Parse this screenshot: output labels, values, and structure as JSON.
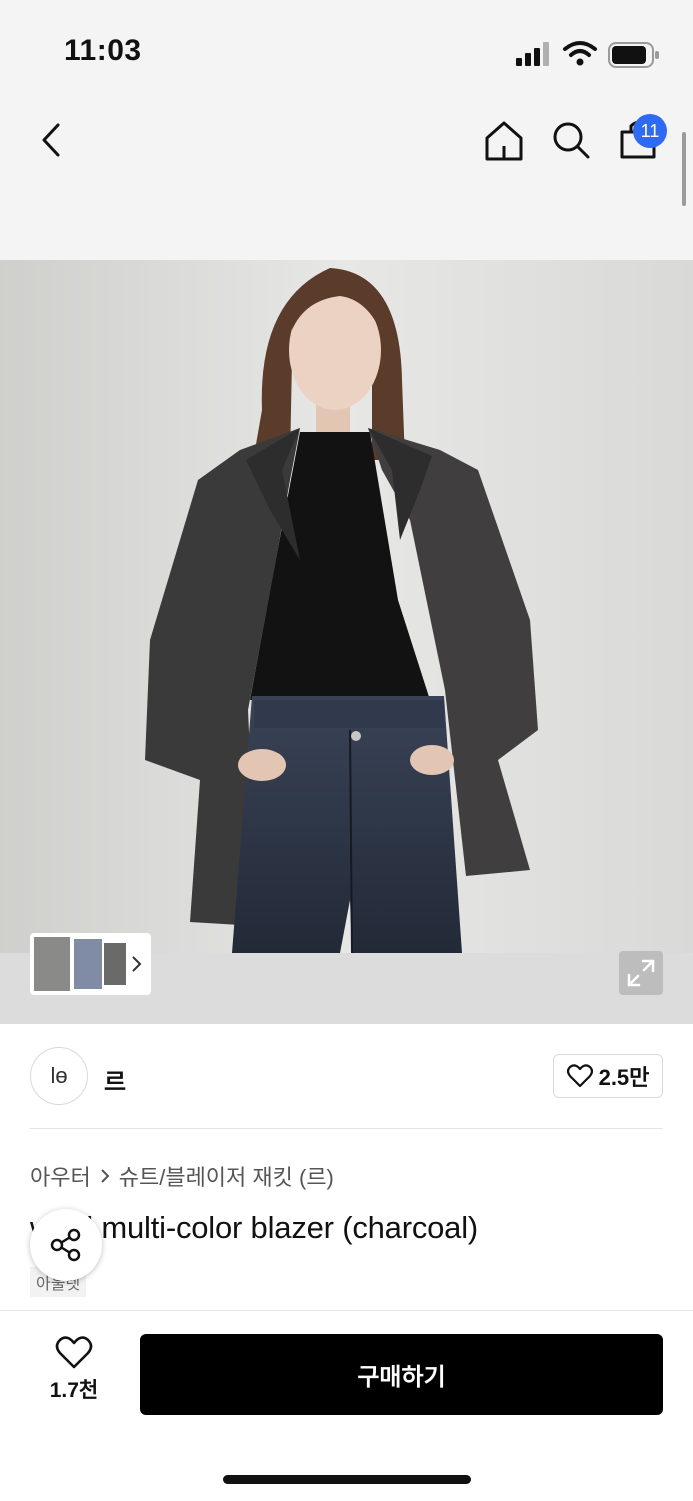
{
  "status_bar": {
    "time": "11:03"
  },
  "nav": {
    "cart_count": "11"
  },
  "product": {
    "brand_logo_text": "lө",
    "brand_name": "르",
    "like_count": "2.5만",
    "breadcrumb": {
      "category": "아우터",
      "subcategory": "슈트/블레이저 재킷 (르)"
    },
    "title": "wool multi-color blazer (charcoal)",
    "tag": "아울렛"
  },
  "bottom_bar": {
    "wish_count": "1.7천",
    "buy_label": "구매하기"
  },
  "colors": {
    "accent_blue": "#2f6bf2",
    "buy_button": "#000000"
  }
}
